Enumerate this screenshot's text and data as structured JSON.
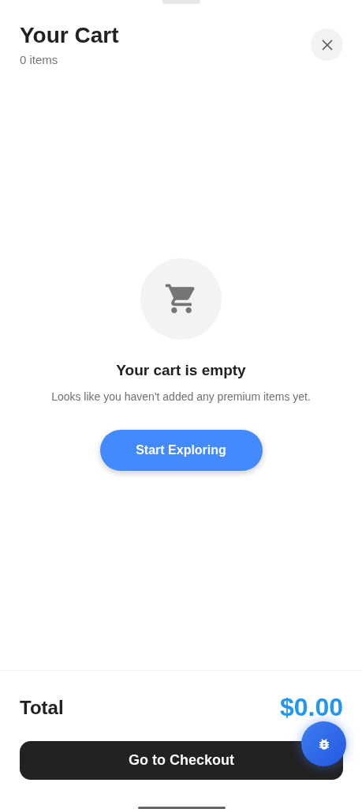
{
  "header": {
    "title": "Your Cart",
    "subtitle": "0 items"
  },
  "empty_state": {
    "title": "Your cart is empty",
    "message": "Looks like you haven't added any premium items yet.",
    "button": "Start Exploring"
  },
  "footer": {
    "total_label": "Total",
    "total_value": "$0.00",
    "checkout_button": "Go to Checkout"
  }
}
